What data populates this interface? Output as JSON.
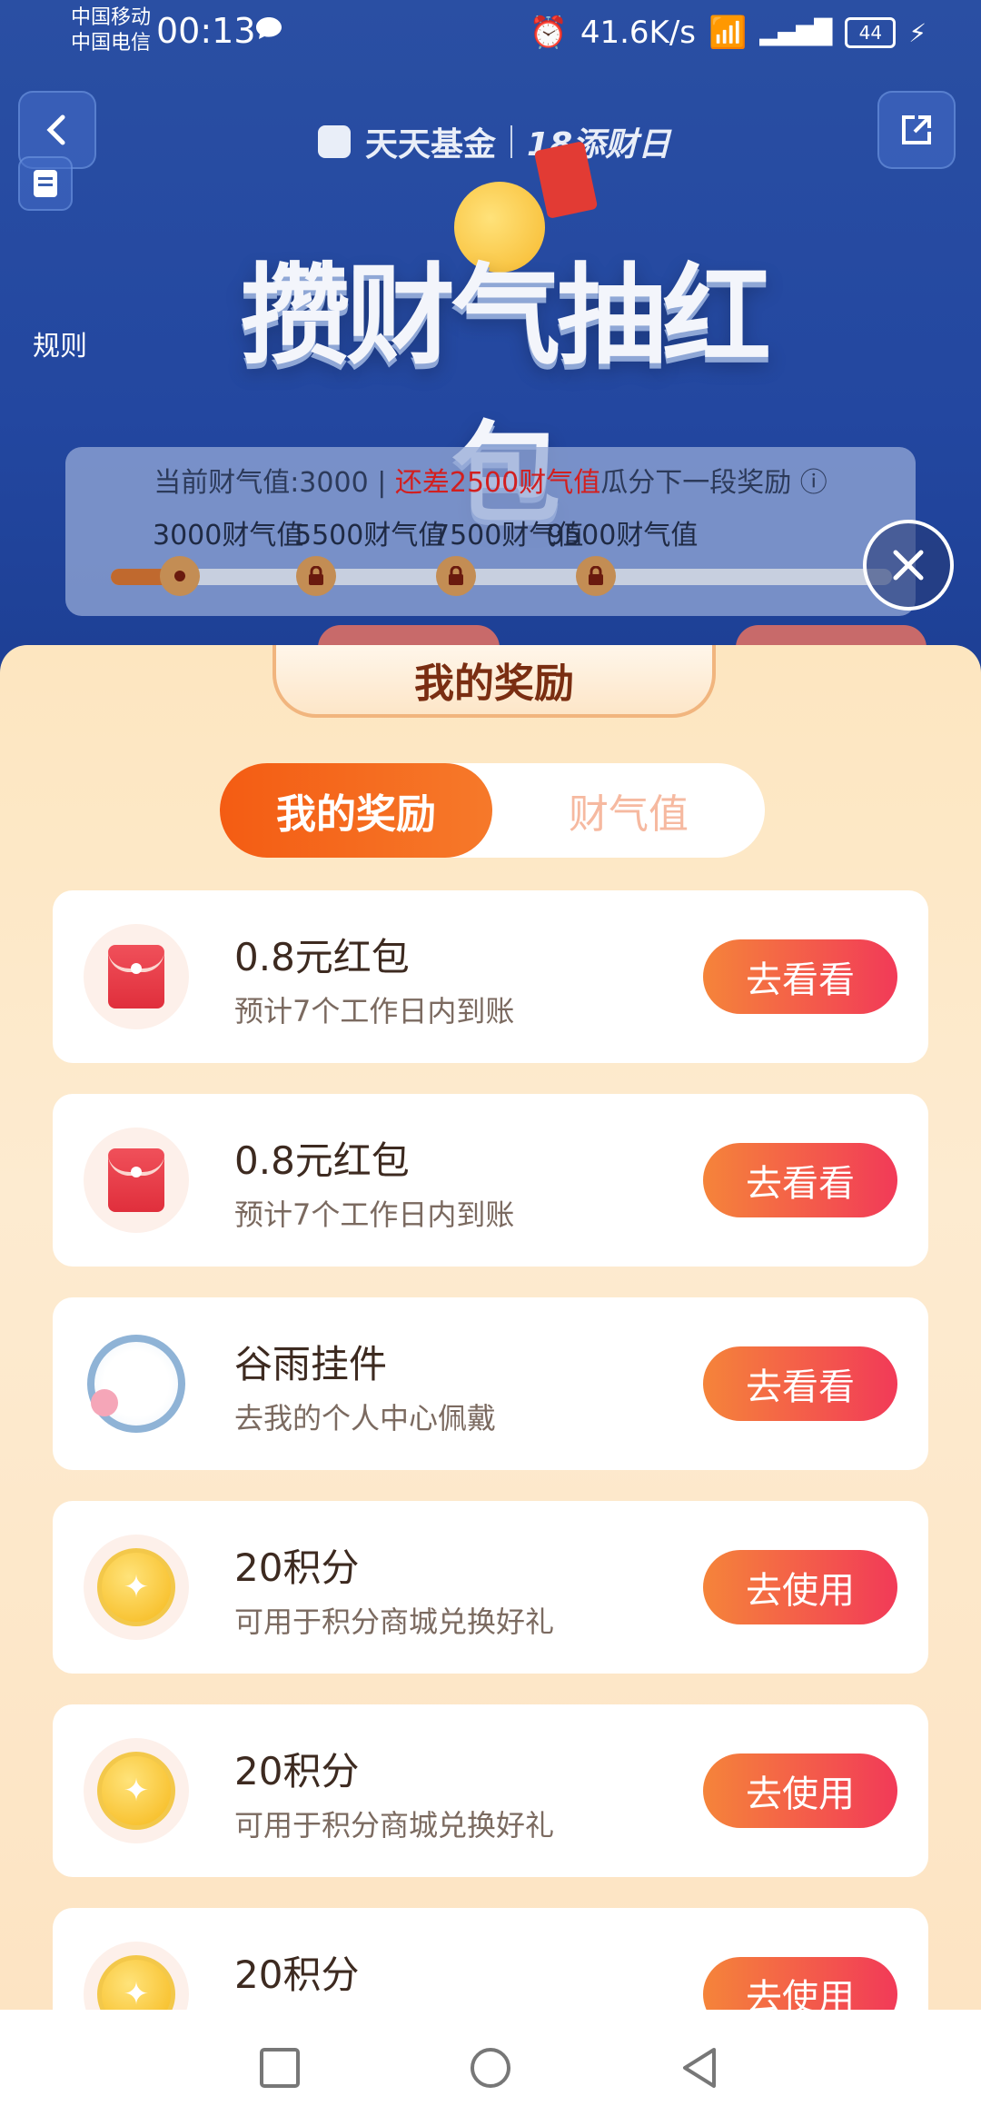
{
  "status_bar": {
    "carrier_1": "中国移动",
    "carrier_2": "中国电信",
    "time": "00:13",
    "speed": "41.6K/s",
    "battery": "44"
  },
  "header": {
    "rules_label": "规则",
    "brand": "天天基金",
    "brand_event": "18添财日",
    "headline": "攒财气抽红包"
  },
  "progress": {
    "current_prefix": "当前财气值:3000",
    "divider": "|",
    "gap_text": "还差2500财气值",
    "suffix": "瓜分下一段奖励",
    "info_icon": "ⓘ",
    "milestones": [
      "3000财气值",
      "5500财气值",
      "7500财气值",
      "9500财气值"
    ],
    "fill_fraction": 0.08
  },
  "sheet": {
    "title": "我的奖励",
    "tabs": [
      "我的奖励",
      "财气值"
    ]
  },
  "rewards": [
    {
      "name": "0.8元红包",
      "desc": "预计7个工作日内到账",
      "action": "去看看",
      "icon": "red-envelope-icon"
    },
    {
      "name": "0.8元红包",
      "desc": "预计7个工作日内到账",
      "action": "去看看",
      "icon": "red-envelope-icon"
    },
    {
      "name": "谷雨挂件",
      "desc": "去我的个人中心佩戴",
      "action": "去看看",
      "icon": "pendant-icon"
    },
    {
      "name": "20积分",
      "desc": "可用于积分商城兑换好礼",
      "action": "去使用",
      "icon": "coin-icon"
    },
    {
      "name": "20积分",
      "desc": "可用于积分商城兑换好礼",
      "action": "去使用",
      "icon": "coin-icon"
    },
    {
      "name": "20积分",
      "desc": "",
      "action": "去使用",
      "icon": "coin-icon"
    }
  ],
  "colors": {
    "accent": "#f45c13",
    "action_start": "#f5843a",
    "action_end": "#f23a58",
    "banner": "#2347a0"
  }
}
